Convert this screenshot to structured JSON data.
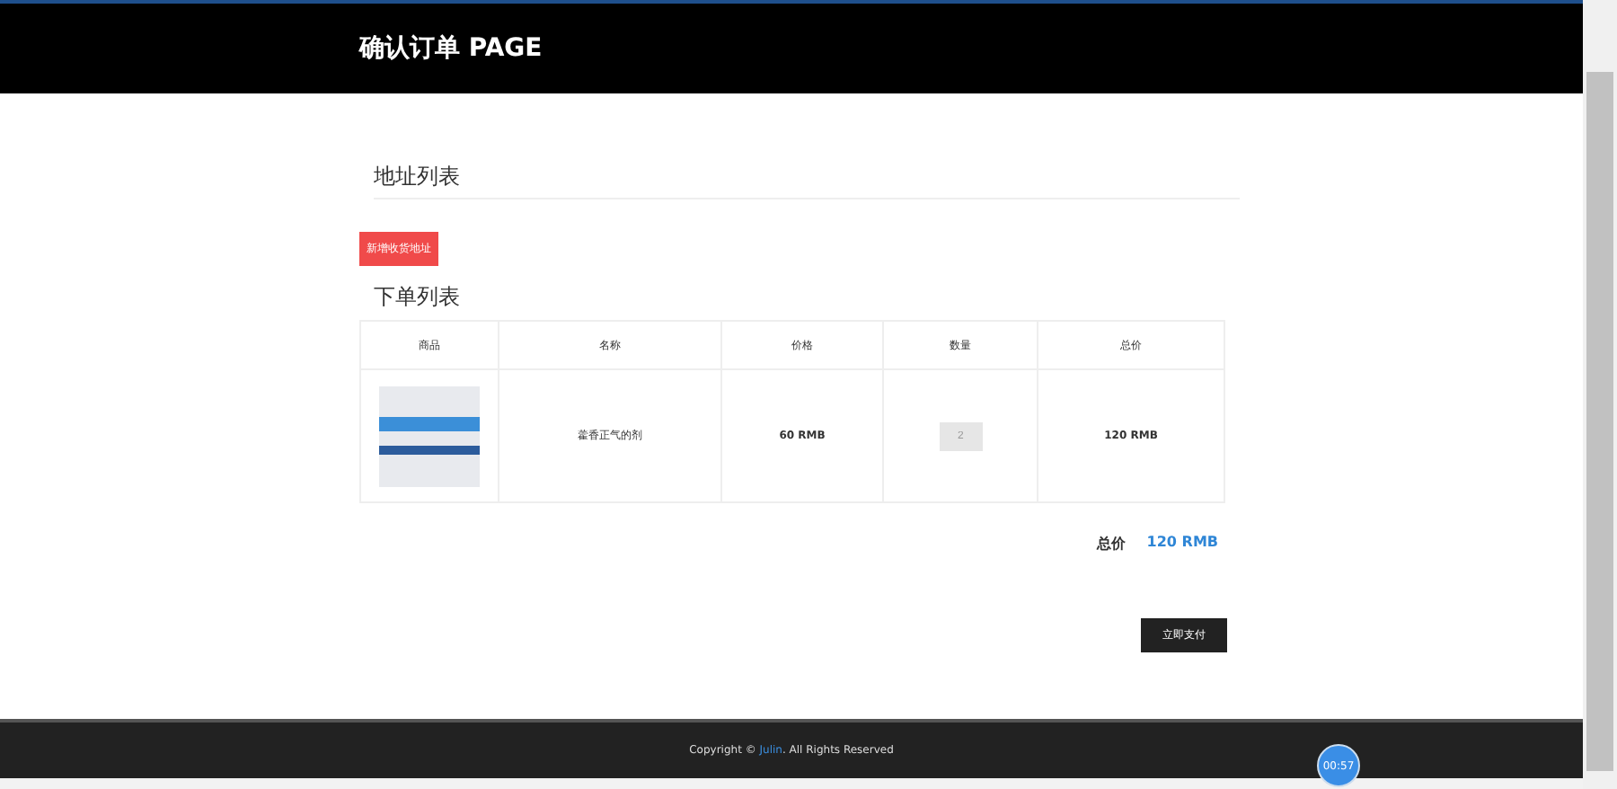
{
  "header": {
    "title": "确认订单 PAGE"
  },
  "address_section": {
    "heading": "地址列表",
    "add_button": "新增收货地址"
  },
  "order_section": {
    "heading": "下单列表",
    "columns": [
      "商品",
      "名称",
      "价格",
      "数量",
      "总价"
    ],
    "rows": [
      {
        "name": "藿香正气的剂",
        "price": "60 RMB",
        "quantity": "2",
        "subtotal": "120 RMB"
      }
    ]
  },
  "total": {
    "label": "总价",
    "value": "120 RMB"
  },
  "pay_button": "立即支付",
  "footer": {
    "before": "Copyright © ",
    "link": "Julin",
    "after": ". All Rights Reserved"
  },
  "timer": "00:57"
}
